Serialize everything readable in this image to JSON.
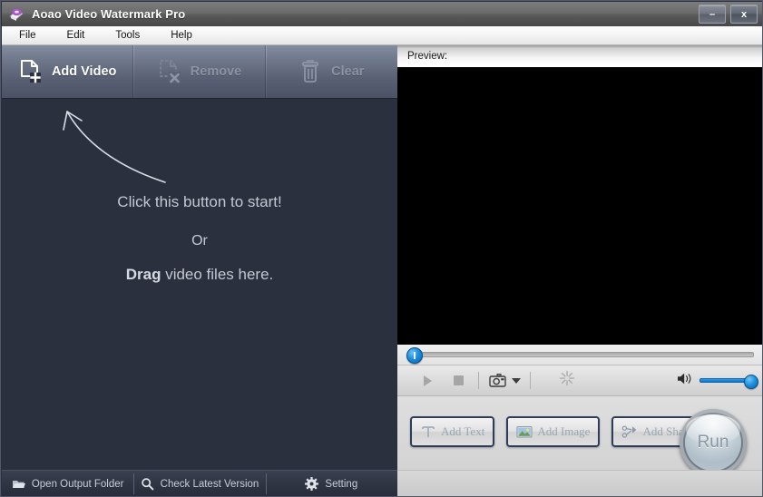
{
  "window": {
    "title": "Aoao Video Watermark Pro",
    "app_icon": "app-icon",
    "buttons": {
      "minimize": "–",
      "close": "x"
    }
  },
  "menubar": {
    "items": [
      {
        "label": "File"
      },
      {
        "label": "Edit"
      },
      {
        "label": "Tools"
      },
      {
        "label": "Help"
      }
    ]
  },
  "toolbar": {
    "buttons": [
      {
        "label": "Add Video",
        "icon": "add-video-icon",
        "enabled": true
      },
      {
        "label": "Remove",
        "icon": "remove-video-icon",
        "enabled": false
      },
      {
        "label": "Clear",
        "icon": "trash-icon",
        "enabled": false
      }
    ]
  },
  "dropzone": {
    "line1": "Click this button to start!",
    "line2": "Or",
    "drag_word": "Drag",
    "line3_rest": " video files here.",
    "arrow": "curved-arrow-icon"
  },
  "statusbar": {
    "buttons": [
      {
        "label": "Open Output Folder",
        "icon": "folder-icon"
      },
      {
        "label": "Check Latest Version",
        "icon": "search-icon"
      },
      {
        "label": "Setting",
        "icon": "gear-icon"
      }
    ]
  },
  "preview": {
    "header_label": "Preview:",
    "video_background": "#000000",
    "seek_position_percent": 0
  },
  "player_controls": {
    "play": "play-icon",
    "stop": "stop-icon",
    "snapshot": "camera-icon",
    "snapshot_dropdown": "chevron-down-icon",
    "effects": "sparkle-icon",
    "volume_icon": "speaker-icon",
    "volume_percent": 100
  },
  "watermark_tools": {
    "buttons": [
      {
        "label": "Add Text",
        "icon": "text-t-icon",
        "enabled": false
      },
      {
        "label": "Add Image",
        "icon": "picture-icon",
        "enabled": false
      },
      {
        "label": "Add Shape",
        "icon": "shape-icon",
        "enabled": false
      }
    ]
  },
  "run": {
    "label": "Run"
  },
  "colors": {
    "panel_dark": "#2b303e",
    "toolbar_top": "#848ca0",
    "toolbar_bottom": "#4b5266",
    "accent_blue": "#1a8fe0",
    "button_border": "#2c3c5c",
    "right_panel_bg": "#d3d3d3"
  }
}
